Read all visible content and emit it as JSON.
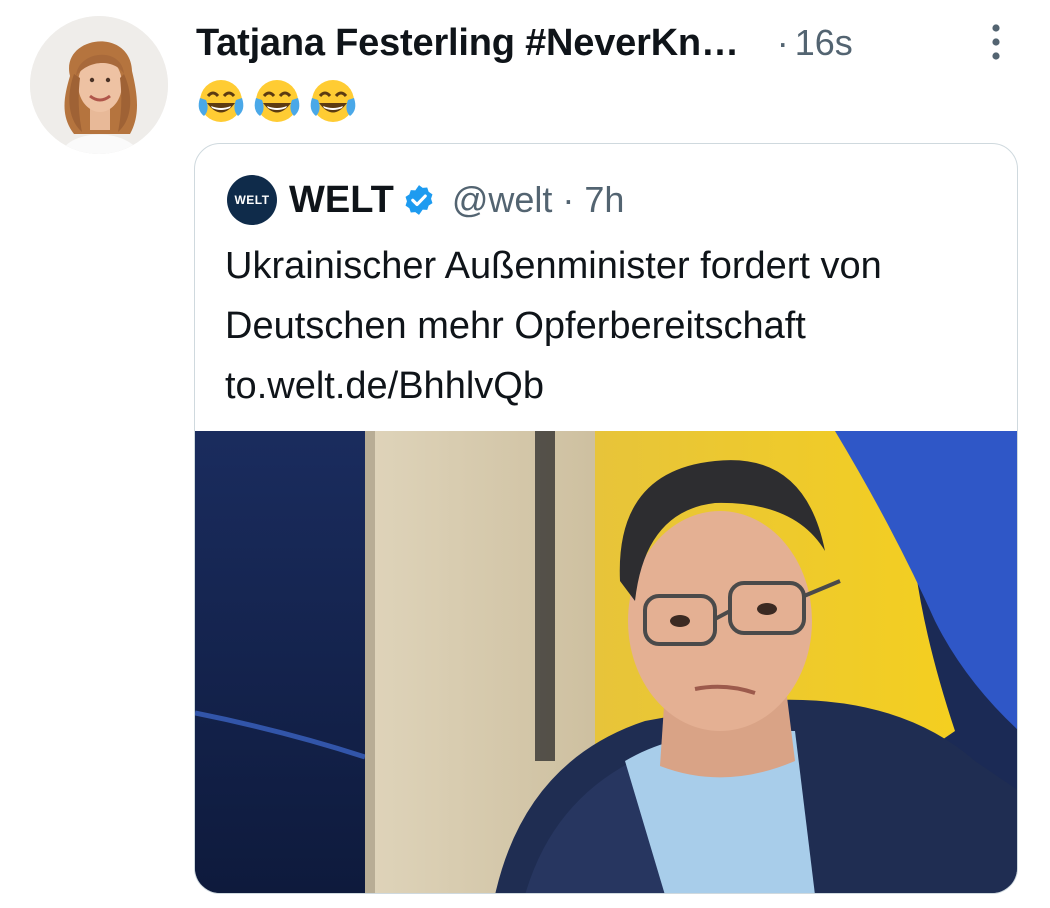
{
  "tweet": {
    "author_name": "Tatjana Festerling #NeverKn…",
    "separator": "·",
    "timestamp": "16s",
    "emojis": [
      "face-with-tears-of-joy",
      "face-with-tears-of-joy",
      "face-with-tears-of-joy"
    ]
  },
  "quoted": {
    "logo_text": "WELT",
    "name": "WELT",
    "verified": true,
    "handle": "@welt",
    "separator": "·",
    "time": "7h",
    "text": "Ukrainischer Außenminister fordert von Deutschen mehr Opferbereitschaft",
    "link_text": "to.welt.de/BhhlvQb"
  },
  "colors": {
    "secondary_text": "#536471",
    "verified": "#1d9bf0",
    "card_border": "#cfd9de",
    "welt_logo_bg": "#0f2b4a"
  },
  "icons": {
    "more": "vertical-ellipsis-icon",
    "verified": "verified-badge-icon"
  }
}
